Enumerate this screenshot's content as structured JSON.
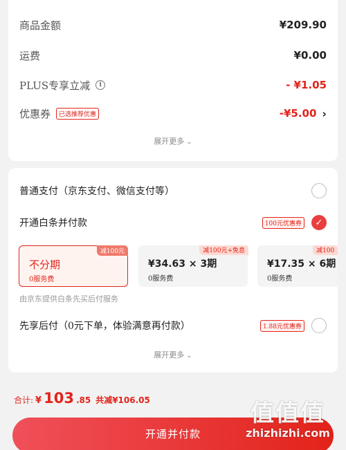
{
  "summary": {
    "goods_label": "商品金额",
    "goods_value": "¥209.90",
    "shipping_label": "运费",
    "shipping_value": "¥0.00",
    "plus_label": "PLUS专享立减",
    "plus_value": "- ¥1.05",
    "coupon_label": "优惠券",
    "coupon_tag": "已选推荐优惠",
    "coupon_value": "-¥5.00",
    "expand_label": "展开更多"
  },
  "payment": {
    "normal_label": "普通支付（京东支付、微信支付等）",
    "baitiao_label": "开通白条并付款",
    "baitiao_tag": "100元优惠券",
    "plans": [
      {
        "badge": "减100元",
        "title": "不分期",
        "fee": "0服务费"
      },
      {
        "badge": "减100元+免息",
        "title": "¥34.63 × 3期",
        "fee": "0服务费"
      },
      {
        "badge": "减100",
        "title": "¥17.35 × 6期",
        "fee": "0服务费"
      }
    ],
    "provider_note": "由京东提供白条先买后付服务",
    "later_label": "先享后付（0元下单，体验满意再付款）",
    "later_tag": "1.88元优惠券",
    "expand_label": "展开更多"
  },
  "footer": {
    "total_label": "合计:",
    "total_currency": "¥",
    "total_int": "103",
    "total_dec": ".85",
    "saved": "共减¥106.05",
    "pay_button": "开通并付款"
  },
  "watermark": {
    "logo": "值值值",
    "text": "zhizhizhi.com"
  },
  "colors": {
    "accent": "#e2231a",
    "background": "#f2f2f2"
  }
}
